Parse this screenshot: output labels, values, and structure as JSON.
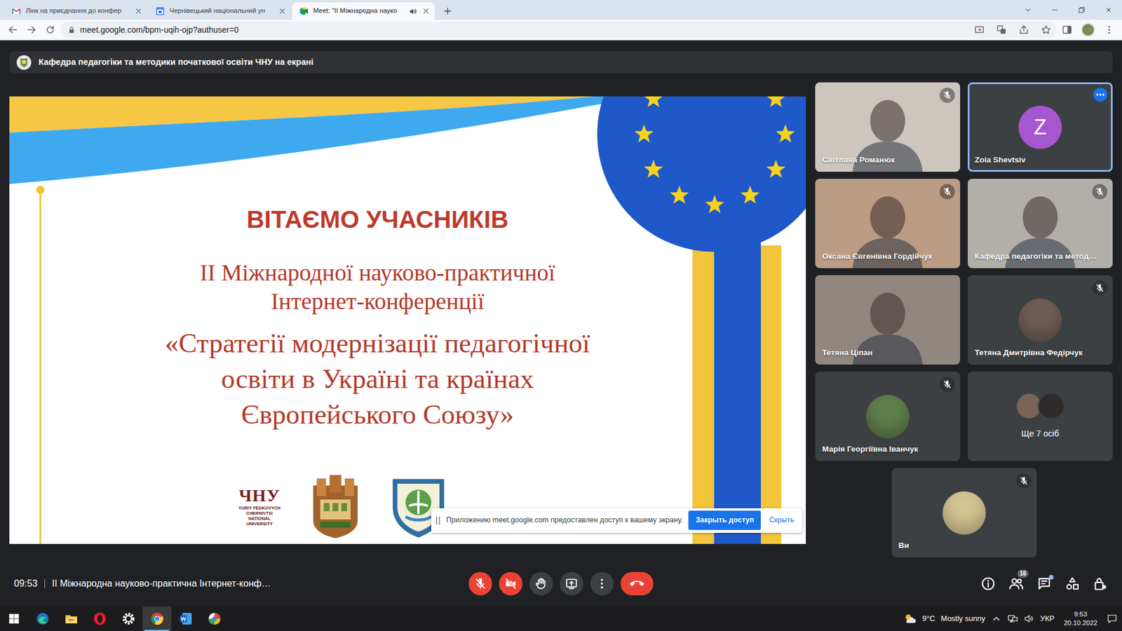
{
  "browser": {
    "tabs": [
      {
        "label": "Лінк на приєднання до конфер",
        "selected": false,
        "audio": false
      },
      {
        "label": "Чернівецький національний ун",
        "selected": false,
        "audio": false
      },
      {
        "label": "Meet: \"II Міжнародна науко",
        "selected": true,
        "audio": true
      }
    ],
    "url": "meet.google.com/bpm-uqih-ojp?authuser=0"
  },
  "meet": {
    "presenting_banner": "Кафедра педагогіки та методики початкової освіти ЧНУ на екрані",
    "slide": {
      "heading": "ВІТАЄМО УЧАСНИКІВ",
      "subtitle": [
        "ІІ Міжнародної науково-практичної",
        "Інтернет-конференції"
      ],
      "title": [
        "«Стратегії модернізації педагогічної",
        "освіти в Україні та країнах",
        "Європейського Союзу»"
      ],
      "university_mark": "ЧНУ",
      "university_name": [
        "YURIY FEDKOVYCH",
        "CHERNIVTSI",
        "NATIONAL",
        "UNIVERSITY"
      ]
    },
    "share_notice": {
      "text": "Приложению meet.google.com предоставлен доступ к вашему экрану.",
      "stop": "Закрыть доступ",
      "hide": "Скрыть"
    },
    "participants": [
      {
        "name": "Світлана Романюк",
        "kind": "video",
        "muted": true,
        "speaking": false,
        "menu": false,
        "color": "#cdc6bf"
      },
      {
        "name": "Zoia Shevtsiv",
        "kind": "letter",
        "letter": "Z",
        "muted": false,
        "speaking": true,
        "menu": true,
        "color": "#a656cf"
      },
      {
        "name": "Оксана Євгенівна Гордійчук",
        "kind": "video",
        "muted": true,
        "speaking": false,
        "menu": false,
        "color": "#bb9c84"
      },
      {
        "name": "Кафедра педагогіки та метод…",
        "kind": "video",
        "muted": true,
        "speaking": false,
        "menu": false,
        "color": "#b2afaa"
      },
      {
        "name": "Тетяна Ціпан",
        "kind": "video",
        "muted": false,
        "speaking": false,
        "menu": false,
        "color": "#918781"
      },
      {
        "name": "Тетяна Дмитрівна Федірчук",
        "kind": "photo",
        "muted": true,
        "speaking": false,
        "menu": false,
        "color": "#6e5d55"
      },
      {
        "name": "Марія Георгіївна Іванчук",
        "kind": "photo",
        "muted": true,
        "speaking": false,
        "menu": false,
        "color": "#5f7f4c"
      },
      {
        "name": "Ще 7 осіб",
        "kind": "group",
        "muted": false,
        "speaking": false,
        "menu": false,
        "color": "#7a6357"
      },
      {
        "name": "Ви",
        "kind": "photo",
        "muted": true,
        "speaking": false,
        "menu": false,
        "color": "#d5c493"
      }
    ],
    "meeting_time": "09:53",
    "meeting_title": "II Міжнародна науково-практична Інтернет-конф…",
    "mic_on": false,
    "camera_on": false,
    "people_count": "16",
    "chat_unread": true
  },
  "taskbar": {
    "apps": [
      {
        "selected": false
      },
      {
        "selected": false
      },
      {
        "selected": false
      },
      {
        "selected": false
      },
      {
        "selected": true
      },
      {
        "selected": false
      },
      {
        "selected": false
      }
    ],
    "weather_temp": "9°C",
    "weather_text": "Mostly sunny",
    "language": "УКР",
    "time": "9:53",
    "date": "20.10.2022"
  }
}
